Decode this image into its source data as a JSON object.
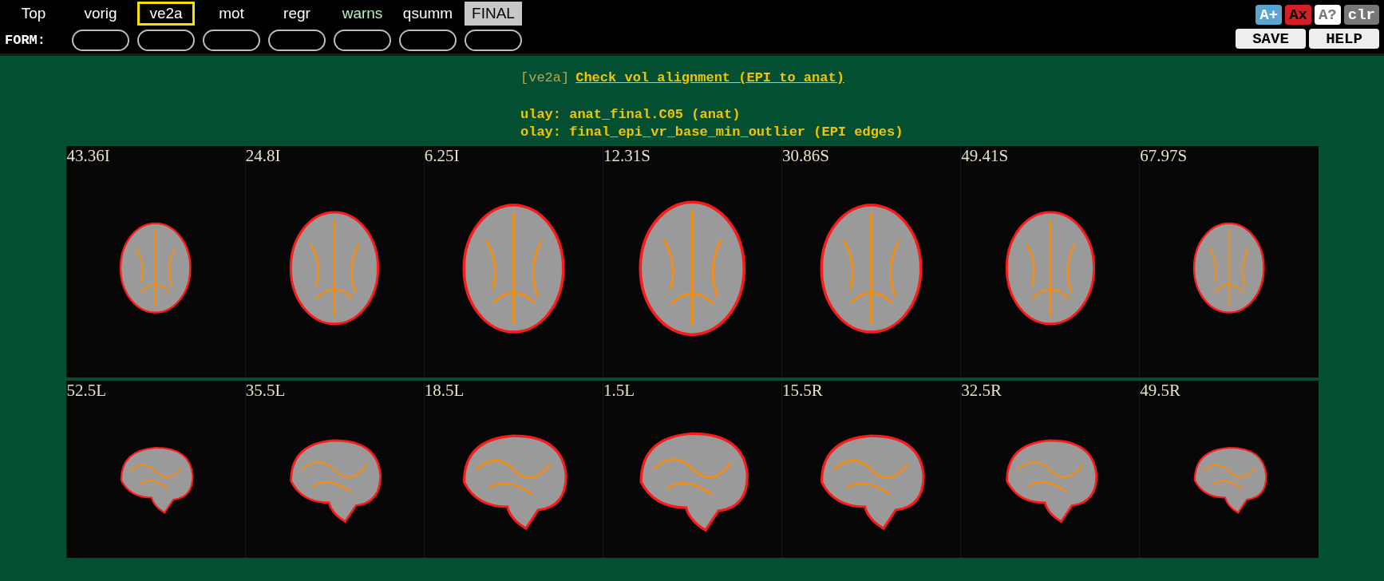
{
  "nav": {
    "tabs": [
      {
        "label": "Top",
        "kind": "home",
        "selected": false
      },
      {
        "label": "vorig",
        "kind": "block",
        "selected": false
      },
      {
        "label": "ve2a",
        "kind": "block",
        "selected": true
      },
      {
        "label": "mot",
        "kind": "block",
        "selected": false
      },
      {
        "label": "regr",
        "kind": "block",
        "selected": false
      },
      {
        "label": "warns",
        "kind": "warn",
        "selected": false
      },
      {
        "label": "qsumm",
        "kind": "block",
        "selected": false
      },
      {
        "label": "FINAL",
        "kind": "final",
        "selected": false
      }
    ],
    "form_label": "FORM:",
    "tools": [
      {
        "label": "A+",
        "kind": "plus"
      },
      {
        "label": "Ax",
        "kind": "x"
      },
      {
        "label": "A?",
        "kind": "q"
      },
      {
        "label": "clr",
        "kind": "clr"
      }
    ],
    "buttons": [
      "SAVE",
      "HELP"
    ]
  },
  "section": {
    "tag": "[ve2a]",
    "title": "Check vol alignment (EPI to anat)",
    "lines": [
      "ulay: anat_final.C05 (anat)",
      "olay: final_epi_vr_base_min_outlier (EPI edges)"
    ]
  },
  "montages": [
    {
      "kind": "axial",
      "labels": [
        "43.36I",
        "24.8I",
        "6.25I",
        "12.31S",
        "30.86S",
        "49.41S",
        "67.97S"
      ]
    },
    {
      "kind": "sagittal",
      "labels": [
        "52.5L",
        "35.5L",
        "18.5L",
        "1.5L",
        "15.5R",
        "32.5R",
        "49.5R"
      ]
    }
  ]
}
